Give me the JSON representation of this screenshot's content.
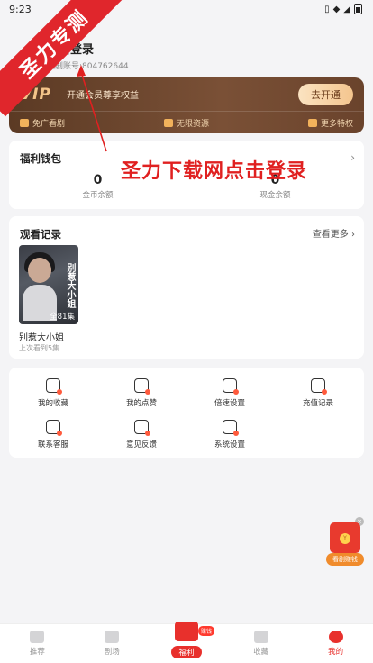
{
  "status_bar": {
    "time": "9:23",
    "icons": [
      "vibrate-icon",
      "wifi-icon",
      "signal-icon",
      "battery-icon"
    ]
  },
  "watermark": {
    "ribbon_text": "圣力专测",
    "annotation_text": "圣力下载网点击登录"
  },
  "profile": {
    "login_text": "点击登录",
    "account_id": "短剧账号:804762644"
  },
  "vip": {
    "logo": "VIP",
    "description": "开通会员尊享权益",
    "button_label": "去开通",
    "perks": [
      "免广看剧",
      "无限资源",
      "更多特权"
    ]
  },
  "wallet": {
    "title": "福利钱包",
    "coins_value": "0",
    "coins_label": "金币余额",
    "cash_value": "0",
    "cash_label": "现金余额"
  },
  "history": {
    "title": "观看记录",
    "more_label": "查看更多",
    "item": {
      "poster_title": "别惹大小姐",
      "episodes": "全81集",
      "name": "别惹大小姐",
      "progress": "上次看到5集"
    }
  },
  "tools": [
    "我的收藏",
    "我的点赞",
    "倍速设置",
    "充值记录",
    "联系客服",
    "意见反馈",
    "系统设置"
  ],
  "red_packet": {
    "coin_glyph": "Y",
    "label": "看剧赚钱"
  },
  "tabbar": {
    "new_badge": "赚钱",
    "tabs": [
      "推荐",
      "剧场",
      "福利",
      "收藏",
      "我的"
    ]
  },
  "colors": {
    "accent": "#e8302c",
    "vip_bg": "#6a432c",
    "vip_gold": "#f3c489"
  }
}
